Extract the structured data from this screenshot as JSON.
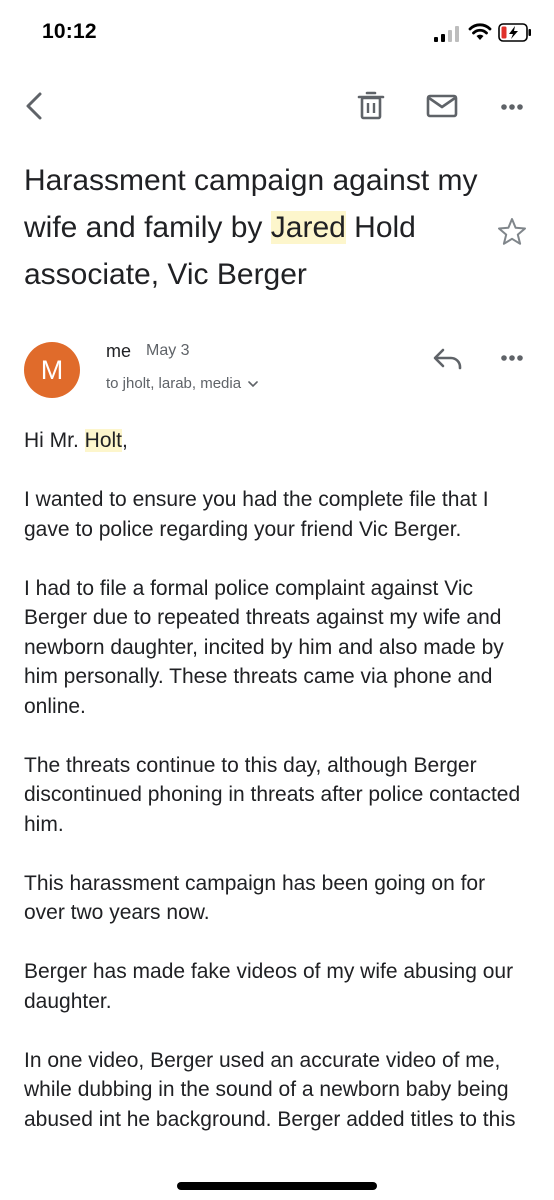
{
  "status_bar": {
    "time": "10:12",
    "icons": [
      "signal-icon",
      "wifi-icon",
      "battery-charging-icon"
    ]
  },
  "toolbar": {
    "back_icon": "back-arrow-icon",
    "delete_icon": "trash-icon",
    "mail_icon": "envelope-icon",
    "more_icon": "more-horizontal-icon"
  },
  "subject": {
    "part1": "Harassment campaign against my wife and family by ",
    "highlight": "Jared",
    "part2": " Hold associate, Vic Berger",
    "star_icon": "star-outline-icon"
  },
  "message": {
    "avatar_letter": "M",
    "avatar_color": "#e06b2b",
    "sender": "me",
    "date": "May 3",
    "recipients": "to jholt, larab, media",
    "reply_icon": "reply-icon",
    "more_icon": "more-horizontal-icon",
    "greeting_prefix": "Hi Mr. ",
    "greeting_highlight": "Holt",
    "greeting_suffix": ",",
    "paragraphs": [
      "I wanted to ensure you had the complete file that I gave to police regarding your friend Vic Berger.",
      "I had to file a formal police complaint against Vic Berger due to repeated threats against my wife and newborn daughter, incited by him and also made by him personally. These threats came via phone and online.",
      "The threats continue to this day, although Berger discontinued phoning in threats after police contacted him.",
      "This harassment campaign has been going on for over two years now.",
      "Berger has made fake videos of my wife abusing our daughter.",
      "In one video, Berger used an accurate video of me, while dubbing in the sound of a newborn baby being abused int he background. Berger added titles to this"
    ]
  },
  "colors": {
    "highlight": "#fdf6cc",
    "text": "#202124",
    "secondary": "#5f6368"
  }
}
